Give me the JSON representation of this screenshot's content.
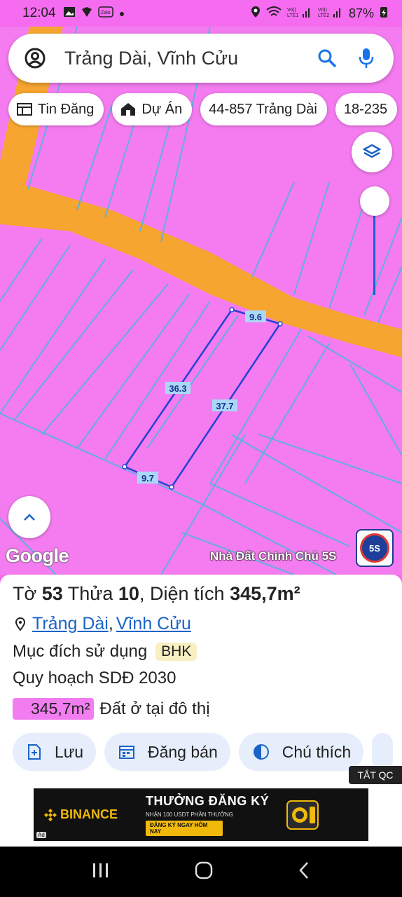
{
  "status_bar": {
    "time": "12:04",
    "battery": "87%",
    "app_icons": [
      "gallery-icon",
      "shield-icon",
      "zalo-icon",
      "dot-icon"
    ],
    "right_icons": [
      "location-icon",
      "wifi-icon",
      "volte1-signal-icon",
      "volte2-signal-icon",
      "battery-charging-icon"
    ]
  },
  "search": {
    "query": "Trảng Dài, Vĩnh Cửu"
  },
  "chips": [
    {
      "label": "Tin Đăng",
      "icon": "listing-icon"
    },
    {
      "label": "Dự Án",
      "icon": "project-icon"
    },
    {
      "label": "44-857 Trảng Dài",
      "icon": ""
    },
    {
      "label": "18-235",
      "icon": ""
    }
  ],
  "map": {
    "plot_dims": {
      "top": "9.6",
      "left": "36.3",
      "right": "37.7",
      "bottom": "9.7"
    },
    "google_label": "Google",
    "brand_label": "Nhà Đất Chính Chủ 5S",
    "brand_logo_text": "5S",
    "colors": {
      "land": "#f47cf0",
      "road": "#f6a531",
      "boundary": "#62aee0",
      "plot": "#2541d3"
    }
  },
  "parcel": {
    "to_label": "Tờ",
    "to_value": "53",
    "thua_label": "Thửa",
    "thua_value": "10",
    "area_label": "Diện tích",
    "area_value": "345,7m²",
    "location_parts": [
      "Trảng Dài",
      "Vĩnh Cửu"
    ],
    "location_sep": ",",
    "purpose_label": "Mục đích sử dụng",
    "purpose_code": "BHK",
    "plan_label": "Quy hoạch SDĐ 2030",
    "plan_area": "345,7m²",
    "plan_use": "Đất ở tại đô thị"
  },
  "actions": [
    {
      "label": "Lưu",
      "icon": "save-add-icon"
    },
    {
      "label": "Đăng bán",
      "icon": "calendar-icon"
    },
    {
      "label": "Chú thích",
      "icon": "contrast-icon"
    }
  ],
  "ad": {
    "close_label": "TẮT QC",
    "brand": "BINANCE",
    "headline": "THƯỞNG ĐĂNG KÝ",
    "subline": "NHẬN 100 USDT PHẦN THƯỞNG",
    "cta": "ĐĂNG KÝ NGAY HÔM NAY",
    "ad_mark": "Ad"
  }
}
